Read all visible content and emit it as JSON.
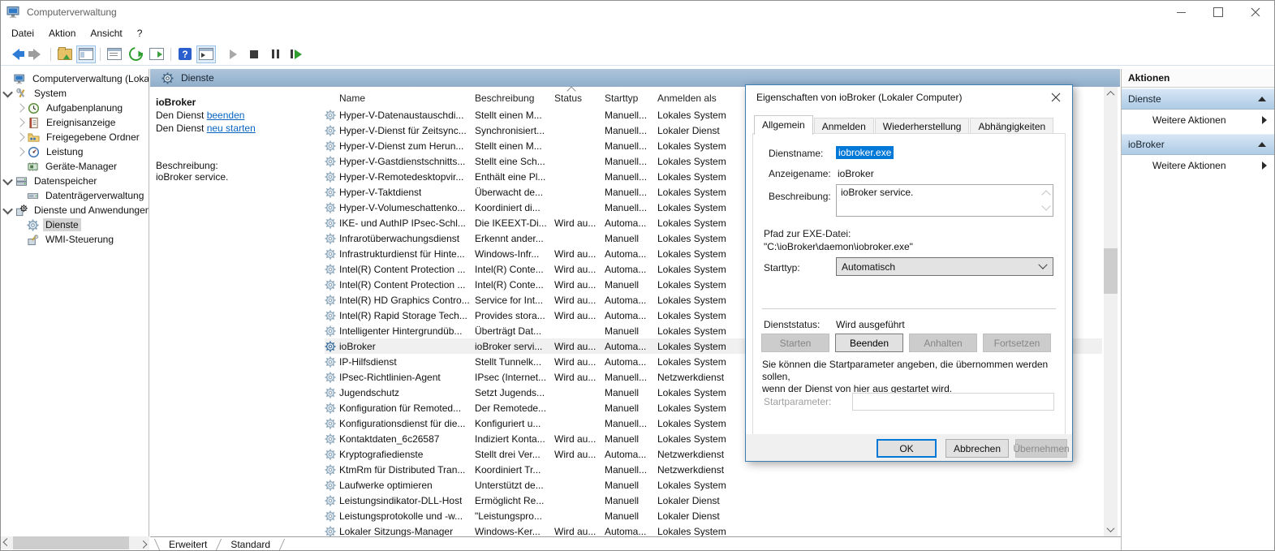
{
  "window": {
    "title": "Computerverwaltung"
  },
  "menubar": {
    "items": [
      "Datei",
      "Aktion",
      "Ansicht",
      "?"
    ]
  },
  "tree": {
    "items": [
      {
        "label": "Computerverwaltung (Lokal)"
      },
      {
        "label": "System"
      },
      {
        "label": "Aufgabenplanung"
      },
      {
        "label": "Ereignisanzeige"
      },
      {
        "label": "Freigegebene Ordner"
      },
      {
        "label": "Leistung"
      },
      {
        "label": "Geräte-Manager"
      },
      {
        "label": "Datenspeicher"
      },
      {
        "label": "Datenträgerverwaltung"
      },
      {
        "label": "Dienste und Anwendungen"
      },
      {
        "label": "Dienste",
        "selected": true
      },
      {
        "label": "WMI-Steuerung"
      }
    ]
  },
  "panel": {
    "header": "Dienste",
    "extended": {
      "service_name": "ioBroker",
      "stop_prefix": "Den Dienst ",
      "stop_link": "beenden",
      "restart_prefix": "Den Dienst ",
      "restart_link": "neu starten",
      "description_label": "Beschreibung:",
      "description": "ioBroker service."
    },
    "table": {
      "columns": [
        "Name",
        "Beschreibung",
        "Status",
        "Starttyp",
        "Anmelden als"
      ],
      "rows": [
        {
          "name": "Hyper-V-Datenaustauschdi...",
          "desc": "Stellt einen M...",
          "status": "",
          "start": "Manuell...",
          "logon": "Lokales System"
        },
        {
          "name": "Hyper-V-Dienst für Zeitsync...",
          "desc": "Synchronisiert...",
          "status": "",
          "start": "Manuell...",
          "logon": "Lokaler Dienst"
        },
        {
          "name": "Hyper-V-Dienst zum Herun...",
          "desc": "Stellt einen M...",
          "status": "",
          "start": "Manuell...",
          "logon": "Lokales System"
        },
        {
          "name": "Hyper-V-Gastdienstschnitts...",
          "desc": "Stellt eine Sch...",
          "status": "",
          "start": "Manuell...",
          "logon": "Lokales System"
        },
        {
          "name": "Hyper-V-Remotedesktopvir...",
          "desc": "Enthält eine Pl...",
          "status": "",
          "start": "Manuell...",
          "logon": "Lokales System"
        },
        {
          "name": "Hyper-V-Taktdienst",
          "desc": "Überwacht de...",
          "status": "",
          "start": "Manuell...",
          "logon": "Lokales System"
        },
        {
          "name": "Hyper-V-Volumeschattenko...",
          "desc": "Koordiniert di...",
          "status": "",
          "start": "Manuell...",
          "logon": "Lokales System"
        },
        {
          "name": "IKE- und AuthIP IPsec-Schl...",
          "desc": "Die IKEEXT-Di...",
          "status": "Wird au...",
          "start": "Automa...",
          "logon": "Lokales System"
        },
        {
          "name": "Infrarotüberwachungsdienst",
          "desc": "Erkennt ander...",
          "status": "",
          "start": "Manuell",
          "logon": "Lokales System"
        },
        {
          "name": "Infrastrukturdienst für Hinte...",
          "desc": "Windows-Infr...",
          "status": "Wird au...",
          "start": "Automa...",
          "logon": "Lokales System"
        },
        {
          "name": "Intel(R) Content Protection ...",
          "desc": "Intel(R) Conte...",
          "status": "Wird au...",
          "start": "Automa...",
          "logon": "Lokales System"
        },
        {
          "name": "Intel(R) Content Protection ...",
          "desc": "Intel(R) Conte...",
          "status": "Wird au...",
          "start": "Manuell",
          "logon": "Lokales System"
        },
        {
          "name": "Intel(R) HD Graphics Contro...",
          "desc": "Service for Int...",
          "status": "Wird au...",
          "start": "Automa...",
          "logon": "Lokales System"
        },
        {
          "name": "Intel(R) Rapid Storage Tech...",
          "desc": "Provides stora...",
          "status": "Wird au...",
          "start": "Automa...",
          "logon": "Lokales System"
        },
        {
          "name": "Intelligenter Hintergrundüb...",
          "desc": "Überträgt Dat...",
          "status": "",
          "start": "Manuell",
          "logon": "Lokales System"
        },
        {
          "name": "ioBroker",
          "desc": "ioBroker servi...",
          "status": "Wird au...",
          "start": "Automa...",
          "logon": "Lokales System",
          "selected": true
        },
        {
          "name": "IP-Hilfsdienst",
          "desc": "Stellt Tunnelk...",
          "status": "Wird au...",
          "start": "Automa...",
          "logon": "Lokales System"
        },
        {
          "name": "IPsec-Richtlinien-Agent",
          "desc": "IPsec (Internet...",
          "status": "Wird au...",
          "start": "Manuell...",
          "logon": "Netzwerkdienst"
        },
        {
          "name": "Jugendschutz",
          "desc": "Setzt Jugends...",
          "status": "",
          "start": "Manuell",
          "logon": "Lokales System"
        },
        {
          "name": "Konfiguration für Remoted...",
          "desc": "Der Remotede...",
          "status": "",
          "start": "Manuell",
          "logon": "Lokales System"
        },
        {
          "name": "Konfigurationsdienst für die...",
          "desc": "Konfiguriert u...",
          "status": "",
          "start": "Manuell...",
          "logon": "Lokales System"
        },
        {
          "name": "Kontaktdaten_6c26587",
          "desc": "Indiziert Konta...",
          "status": "Wird au...",
          "start": "Manuell",
          "logon": "Lokales System"
        },
        {
          "name": "Kryptografiedienste",
          "desc": "Stellt drei Ver...",
          "status": "Wird au...",
          "start": "Automa...",
          "logon": "Netzwerkdienst"
        },
        {
          "name": "KtmRm für Distributed Tran...",
          "desc": "Koordiniert Tr...",
          "status": "",
          "start": "Manuell...",
          "logon": "Netzwerkdienst"
        },
        {
          "name": "Laufwerke optimieren",
          "desc": "Unterstützt de...",
          "status": "",
          "start": "Manuell",
          "logon": "Lokales System"
        },
        {
          "name": "Leistungsindikator-DLL-Host",
          "desc": "Ermöglicht Re...",
          "status": "",
          "start": "Manuell",
          "logon": "Lokaler Dienst"
        },
        {
          "name": "Leistungsprotokolle und -w...",
          "desc": "\"Leistungspro...",
          "status": "",
          "start": "Manuell",
          "logon": "Lokaler Dienst"
        },
        {
          "name": "Lokaler Sitzungs-Manager",
          "desc": "Windows-Ker...",
          "status": "Wird au...",
          "start": "Automa...",
          "logon": "Lokales System"
        }
      ]
    },
    "view_tabs": [
      "Erweitert",
      "Standard"
    ]
  },
  "actions_panel": {
    "title": "Aktionen",
    "sections": [
      {
        "header": "Dienste",
        "item": "Weitere Aktionen"
      },
      {
        "header": "ioBroker",
        "item": "Weitere Aktionen"
      }
    ]
  },
  "dialog": {
    "title": "Eigenschaften von ioBroker (Lokaler Computer)",
    "tabs": [
      "Allgemein",
      "Anmelden",
      "Wiederherstellung",
      "Abhängigkeiten"
    ],
    "fields": {
      "service_name_label": "Dienstname:",
      "service_name_value": "iobroker.exe",
      "display_name_label": "Anzeigename:",
      "display_name_value": "ioBroker",
      "description_label": "Beschreibung:",
      "description_value": "ioBroker service.",
      "exe_path_label": "Pfad zur EXE-Datei:",
      "exe_path_value": "\"C:\\ioBroker\\daemon\\iobroker.exe\"",
      "startup_type_label": "Starttyp:",
      "startup_type_value": "Automatisch",
      "service_status_label": "Dienststatus:",
      "service_status_value": "Wird ausgeführt",
      "hint_line1": "Sie können die Startparameter angeben, die übernommen werden sollen,",
      "hint_line2": "wenn der Dienst von hier aus gestartet wird.",
      "start_params_label": "Startparameter:"
    },
    "buttons": {
      "start": "Starten",
      "stop": "Beenden",
      "pause": "Anhalten",
      "resume": "Fortsetzen",
      "ok": "OK",
      "cancel": "Abbrechen",
      "apply": "Übernehmen"
    }
  },
  "colors": {
    "accent_blue": "#0078d7",
    "panel_header_top": "#aec5db",
    "panel_header_bottom": "#90aecb",
    "link_blue": "#0563c1",
    "selected_row": "#f0f0f0",
    "dialog_border": "#3c7fb1"
  }
}
